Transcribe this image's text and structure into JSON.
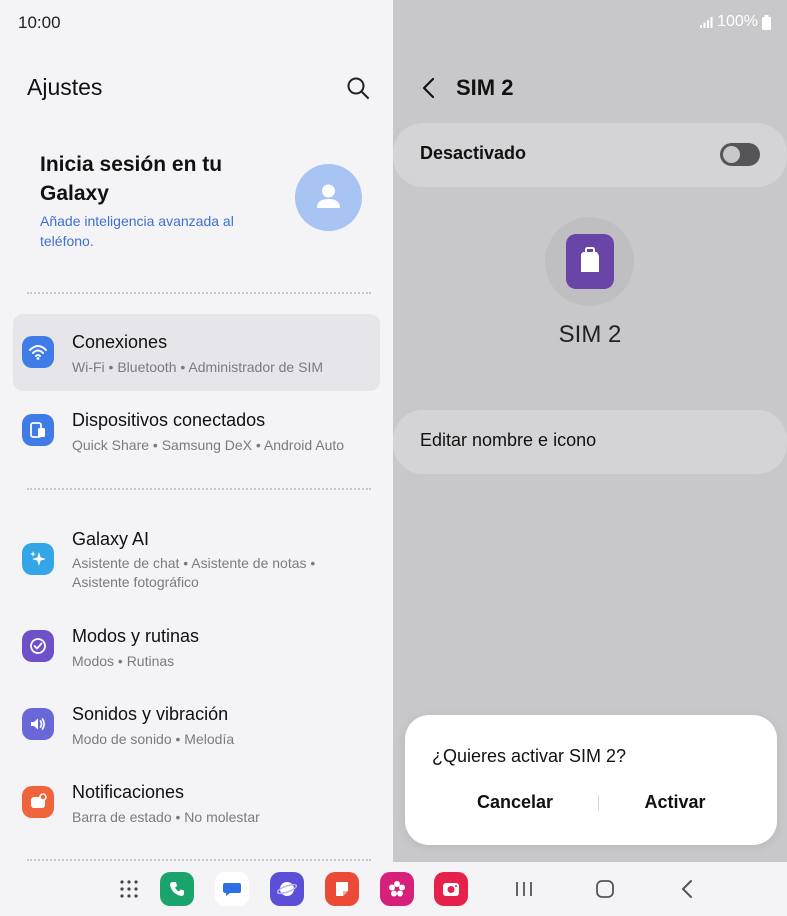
{
  "status_bar": {
    "time": "10:00",
    "battery": "100%"
  },
  "settings": {
    "title": "Ajustes",
    "account": {
      "title": "Inicia sesión en tu Galaxy",
      "subtitle": "Añade inteligencia avanzada al teléfono."
    },
    "items": [
      {
        "title": "Conexiones",
        "subtitle": "Wi-Fi  •  Bluetooth  •  Administrador de SIM",
        "icon": "wifi-icon",
        "color": "#3f7ce8"
      },
      {
        "title": "Dispositivos conectados",
        "subtitle": "Quick Share  •  Samsung DeX  •  Android Auto",
        "icon": "devices-icon",
        "color": "#3f7ce8"
      },
      {
        "title": "Galaxy AI",
        "subtitle_line1": "Asistente de chat  •  Asistente de notas  •",
        "subtitle_line2": "Asistente fotográfico",
        "icon": "sparkle-icon",
        "color": "#34a6e8"
      },
      {
        "title": "Modos y rutinas",
        "subtitle": "Modos  •  Rutinas",
        "icon": "check-circle-icon",
        "color": "#6e50c9"
      },
      {
        "title": "Sonidos y vibración",
        "subtitle": "Modo de sonido  •  Melodía",
        "icon": "speaker-icon",
        "color": "#6a68d8"
      },
      {
        "title": "Notificaciones",
        "subtitle": "Barra de estado  •  No molestar",
        "icon": "notification-icon",
        "color": "#f0643c"
      }
    ]
  },
  "sim": {
    "title": "SIM 2",
    "toggle_label": "Desactivado",
    "toggle_on": false,
    "sim_name": "SIM 2",
    "edit_label": "Editar nombre e icono",
    "icon_color": "#6a45a8"
  },
  "dialog": {
    "question": "¿Quieres activar SIM 2?",
    "cancel": "Cancelar",
    "confirm": "Activar"
  },
  "dock": [
    {
      "name": "apps-grid-icon"
    },
    {
      "name": "phone-app-icon",
      "color": "#1aa36b"
    },
    {
      "name": "messages-app-icon",
      "color": "#2f6fe4"
    },
    {
      "name": "internet-app-icon",
      "color": "#5a4fd6"
    },
    {
      "name": "notes-app-icon",
      "color": "#ea4a36"
    },
    {
      "name": "gallery-app-icon",
      "color": "#d6207a"
    },
    {
      "name": "camera-app-icon",
      "color": "#e5214c"
    }
  ]
}
